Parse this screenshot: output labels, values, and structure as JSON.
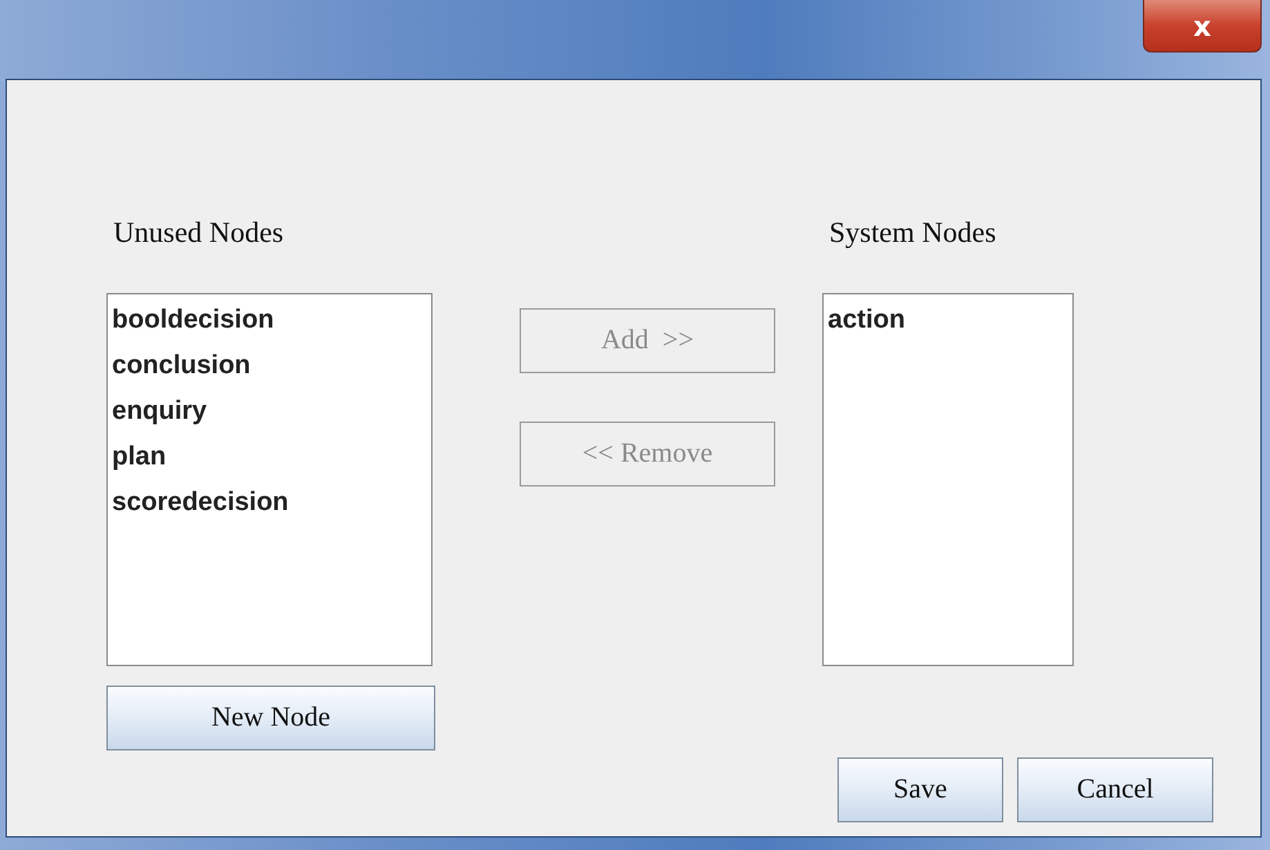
{
  "window": {
    "close_button": "x"
  },
  "unused_nodes": {
    "label": "Unused Nodes",
    "items": [
      {
        "text": "booldecision",
        "selected": false
      },
      {
        "text": "conclusion",
        "selected": false
      },
      {
        "text": "enquiry",
        "selected": false
      },
      {
        "text": "plan",
        "selected": false
      },
      {
        "text": "scoredecision",
        "selected": false
      }
    ],
    "button": {
      "label": "New Node",
      "disabled": false
    }
  },
  "transfer_buttons": [
    {
      "label": "Add  >>",
      "disabled": true
    },
    {
      "label": "<< Remove",
      "disabled": true
    }
  ],
  "system_nodes": {
    "label": "System Nodes",
    "items": [
      {
        "text": "action",
        "selected": false
      }
    ]
  },
  "footer_buttons": [
    {
      "label": "Save",
      "disabled": false
    },
    {
      "label": "Cancel",
      "disabled": false
    }
  ]
}
